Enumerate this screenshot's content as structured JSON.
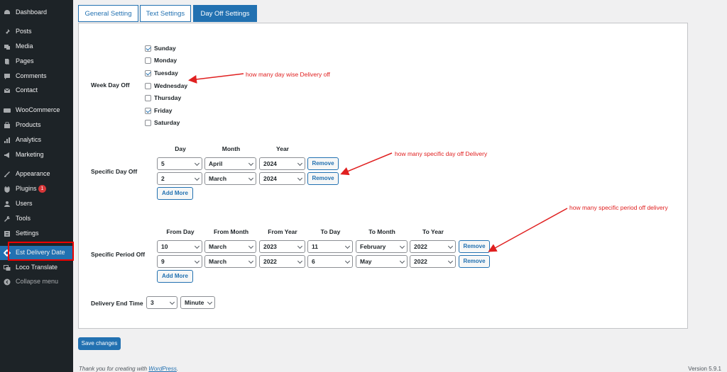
{
  "sidebar": {
    "items": [
      {
        "label": "Dashboard",
        "icon": "dashboard-icon"
      },
      {
        "label": "Posts",
        "icon": "pin-icon"
      },
      {
        "label": "Media",
        "icon": "media-icon"
      },
      {
        "label": "Pages",
        "icon": "pages-icon"
      },
      {
        "label": "Comments",
        "icon": "comments-icon"
      },
      {
        "label": "Contact",
        "icon": "mail-icon"
      },
      {
        "label": "WooCommerce",
        "icon": "woocommerce-icon"
      },
      {
        "label": "Products",
        "icon": "products-icon"
      },
      {
        "label": "Analytics",
        "icon": "analytics-icon"
      },
      {
        "label": "Marketing",
        "icon": "megaphone-icon"
      },
      {
        "label": "Appearance",
        "icon": "brush-icon"
      },
      {
        "label": "Plugins",
        "icon": "plugin-icon",
        "badge": "1"
      },
      {
        "label": "Users",
        "icon": "users-icon"
      },
      {
        "label": "Tools",
        "icon": "wrench-icon"
      },
      {
        "label": "Settings",
        "icon": "settings-icon"
      },
      {
        "label": "Est Delivery Date",
        "icon": "gear-icon"
      },
      {
        "label": "Loco Translate",
        "icon": "translate-icon"
      },
      {
        "label": "Collapse menu",
        "icon": "collapse-icon"
      }
    ]
  },
  "tabs": [
    {
      "label": "General Setting"
    },
    {
      "label": "Text Settings"
    },
    {
      "label": "Day Off Settings"
    }
  ],
  "week_day_off": {
    "label": "Week Day Off",
    "days": [
      {
        "label": "Sunday",
        "checked": true
      },
      {
        "label": "Monday",
        "checked": false
      },
      {
        "label": "Tuesday",
        "checked": true
      },
      {
        "label": "Wednesday",
        "checked": false
      },
      {
        "label": "Thursday",
        "checked": false
      },
      {
        "label": "Friday",
        "checked": true
      },
      {
        "label": "Saturday",
        "checked": false
      }
    ]
  },
  "specific_day_off": {
    "label": "Specific Day Off",
    "headers": [
      "Day",
      "Month",
      "Year"
    ],
    "rows": [
      {
        "day": "5",
        "month": "April",
        "year": "2024"
      },
      {
        "day": "2",
        "month": "March",
        "year": "2024"
      }
    ],
    "remove_label": "Remove",
    "add_label": "Add More"
  },
  "specific_period_off": {
    "label": "Specific Period Off",
    "headers": [
      "From Day",
      "From Month",
      "From Year",
      "To Day",
      "To Month",
      "To Year"
    ],
    "rows": [
      {
        "from_day": "10",
        "from_month": "March",
        "from_year": "2023",
        "to_day": "11",
        "to_month": "February",
        "to_year": "2022"
      },
      {
        "from_day": "9",
        "from_month": "March",
        "from_year": "2022",
        "to_day": "6",
        "to_month": "May",
        "to_year": "2022"
      }
    ],
    "remove_label": "Remove",
    "add_label": "Add More"
  },
  "delivery_end_time": {
    "label": "Delivery End Time",
    "value": "3",
    "unit": "Minute"
  },
  "annotations": {
    "week": "how many day wise Delivery off",
    "specific_day": "how many specific day off Delivery",
    "period": "how many specific period off delivery"
  },
  "colors": {
    "accent": "#2271b1",
    "annotation": "#e02020",
    "sidebar_bg": "#1d2327"
  },
  "save_label": "Save changes",
  "footer": {
    "prefix": "Thank you for creating with ",
    "link": "WordPress",
    "suffix": ".",
    "version": "Version 5.9.1"
  }
}
